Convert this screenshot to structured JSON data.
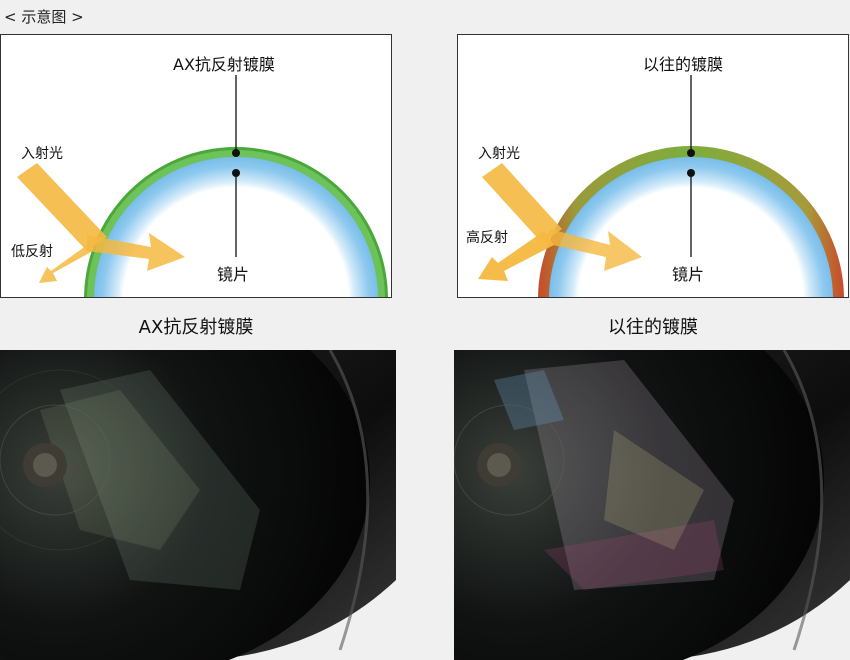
{
  "header": {
    "title": "< 示意图 >"
  },
  "left_panel": {
    "coating_label": "AX抗反射镀膜",
    "incident_label": "入射光",
    "reflection_label": "低反射",
    "lens_label": "镜片",
    "coating_color": "#4aa83a"
  },
  "right_panel": {
    "coating_label": "以往的镀膜",
    "incident_label": "入射光",
    "reflection_label": "高反射",
    "lens_label": "镜片",
    "coating_color": "#8aa03a",
    "edge_color": "#c84a2a"
  },
  "captions": {
    "left": "AX抗反射镀膜",
    "right": "以往的镀膜"
  },
  "colors": {
    "light_beam": "#f5b840",
    "lens_blue": "#8ec9ee"
  }
}
